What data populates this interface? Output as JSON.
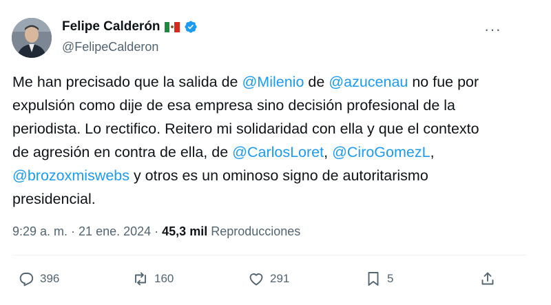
{
  "author": {
    "display_name": "Felipe Calderón",
    "handle": "@FelipeCalderon"
  },
  "more_menu": {
    "label": "···"
  },
  "tweet": {
    "segments": [
      {
        "text": "Me han precisado que la salida de ",
        "mention": false
      },
      {
        "text": "@Milenio",
        "mention": true
      },
      {
        "text": " de ",
        "mention": false
      },
      {
        "text": "@azucenau",
        "mention": true
      },
      {
        "text": " no fue por expulsión como dije de esa empresa sino decisión profesional de la periodista. Lo rectifico. Reitero mi solidaridad con ella y que el contexto de agresión en contra de ella, de ",
        "mention": false
      },
      {
        "text": "@CarlosLoret",
        "mention": true
      },
      {
        "text": ", ",
        "mention": false
      },
      {
        "text": "@CiroGomezL",
        "mention": true
      },
      {
        "text": ", ",
        "mention": false
      },
      {
        "text": "@brozoxmiswebs",
        "mention": true
      },
      {
        "text": " y otros es un ominoso signo de autoritarismo presidencial.",
        "mention": false
      }
    ]
  },
  "meta": {
    "time": "9:29 a. m.",
    "separator": " · ",
    "date": "21 ene. 2024",
    "views_count": "45,3 mil",
    "views_label": "Reproducciones"
  },
  "actions": {
    "replies": "396",
    "reposts": "160",
    "likes": "291",
    "bookmarks": "5"
  },
  "colors": {
    "mention": "#1d9bf0",
    "secondary_text": "#536471",
    "verified": "#1d9bf0"
  },
  "icons": {
    "reply": "reply-icon",
    "repost": "repost-icon",
    "like": "heart-icon",
    "bookmark": "bookmark-icon",
    "share": "share-icon",
    "verified": "verified-badge-icon",
    "flag": "mexico-flag-icon"
  }
}
